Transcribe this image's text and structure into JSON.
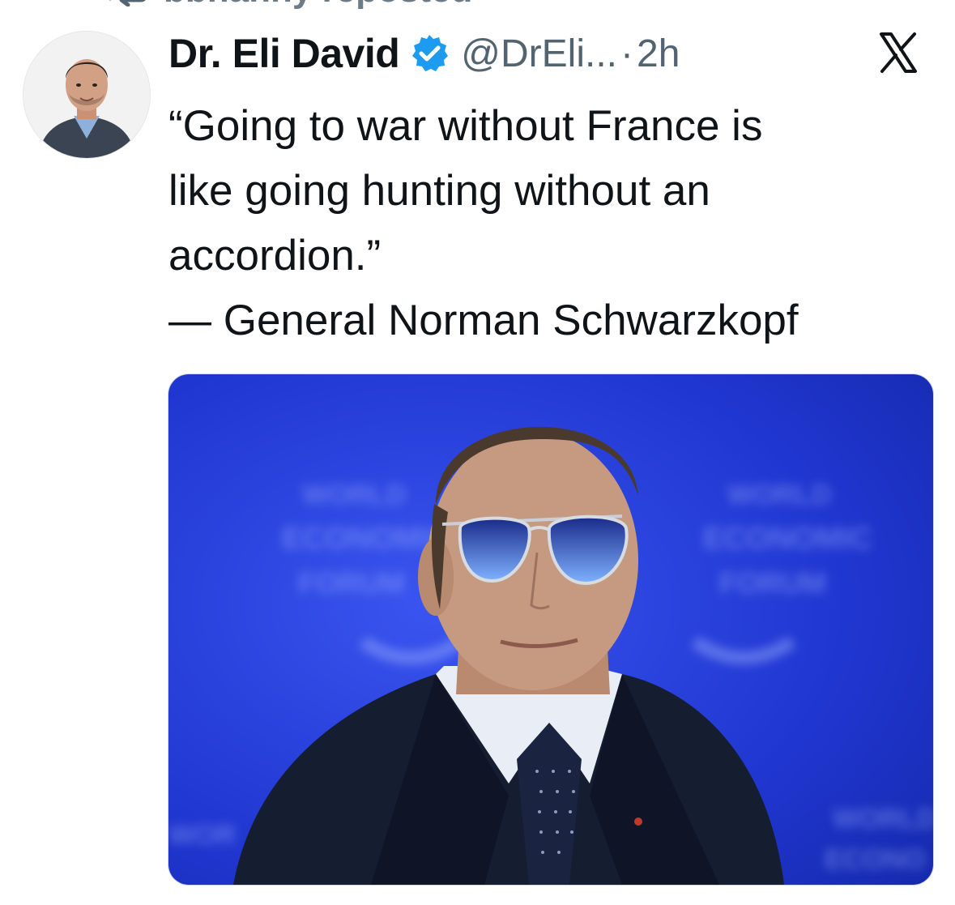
{
  "repost": {
    "label": "bbhanhy reposted",
    "icon": "repost-icon"
  },
  "author": {
    "display_name": "Dr. Eli David",
    "verified": true,
    "verified_icon": "verified-badge-icon",
    "handle": "@DrEli...",
    "separator": "·",
    "time": "2h",
    "avatar_icon": "avatar-photo"
  },
  "platform": {
    "logo_icon": "x-logo-icon"
  },
  "tweet": {
    "lines": [
      "“Going to war without France is",
      "like going hunting without an",
      "accordion.”",
      "— General Norman Schwarzkopf"
    ]
  },
  "media": {
    "type": "photo",
    "background_words": [
      "WORLD",
      "ECONOMIC",
      "FORUM"
    ]
  },
  "colors": {
    "text_primary": "#0f1419",
    "text_secondary": "#536471",
    "verified_blue": "#1d9bf0",
    "media_bg_blue": "#1f33c9"
  }
}
